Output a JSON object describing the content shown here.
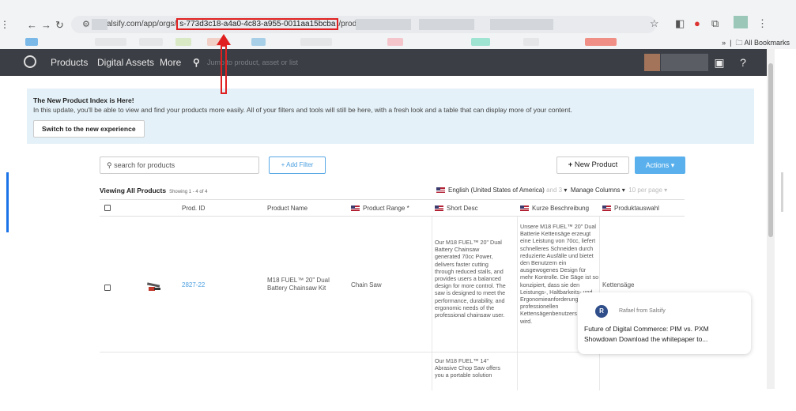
{
  "browser": {
    "url_domain": "salsify.com/app/orgs/",
    "url_highlight": "s-773d3c18-a4a0-4c83-a955-0011aa15bcba",
    "url_rest": "/products",
    "all_bookmarks": "All Bookmarks",
    "more_chevron": "»"
  },
  "nav": {
    "products": "Products",
    "digital_assets": "Digital Assets",
    "more": "More",
    "search_hint": "Jump to product, asset or list"
  },
  "banner": {
    "title": "The New Product Index is Here!",
    "text": "In this update, you'll be able to view and find your products more easily. All of your filters and tools will still be here, with a fresh look and a table that can display more of your content.",
    "button": "Switch to the new experience"
  },
  "toolbar": {
    "search_placeholder": "search for products",
    "add_filter": "+ Add Filter",
    "new_product": "New Product",
    "actions": "Actions"
  },
  "listing": {
    "viewing": "Viewing All Products",
    "showing": "Showing 1 - 4 of 4",
    "language": "English (United States of America)",
    "language_suffix": "and 3",
    "manage_columns": "Manage Columns",
    "per_page": "10 per page"
  },
  "table": {
    "headers": [
      "Prod. ID",
      "Product Name",
      "Product Range *",
      "Short Desc",
      "Kurze Beschreibung",
      "Produktauswahl"
    ],
    "rows": [
      {
        "id": "2827-22",
        "name": "M18 FUEL™ 20\" Dual Battery Chainsaw Kit",
        "range": "Chain Saw",
        "short_desc": "Our M18 FUEL™ 20\" Dual Battery Chainsaw generated 70cc Power, delivers faster cutting through reduced stalls, and provides users a balanced design for more control. The saw is designed to meet the performance, durability, and ergonomic needs of the professional chainsaw user.",
        "kurze": "Unsere M18 FUEL™ 20\" Dual Batterie Kettensäge erzeugt eine Leistung von 70cc, liefert schnelleres Schneiden durch reduzierte Ausfälle und bietet den Benutzern ein ausgewogenes Design für mehr Kontrolle. Die Säge ist so konzipiert, dass sie den Leistungs-, Haltbarkeits- und Ergonomieanforderungen des professionellen Kettensägenbenutzers gerecht wird.",
        "auswahl": "Kettensäge"
      },
      {
        "short_desc": "Our M18 FUEL™ 14\" Abrasive Chop Saw offers you a portable solution"
      }
    ]
  },
  "popup": {
    "avatar_letter": "R",
    "from": "Rafael from Salsify",
    "message": "Future of Digital Commerce: PIM vs. PXM Showdown Download the whitepaper to..."
  },
  "colors": {
    "nav_bg": "#3b3e44",
    "banner_bg": "#e4f1f8",
    "accent": "#5ab0ec",
    "annotation": "#e02020"
  }
}
